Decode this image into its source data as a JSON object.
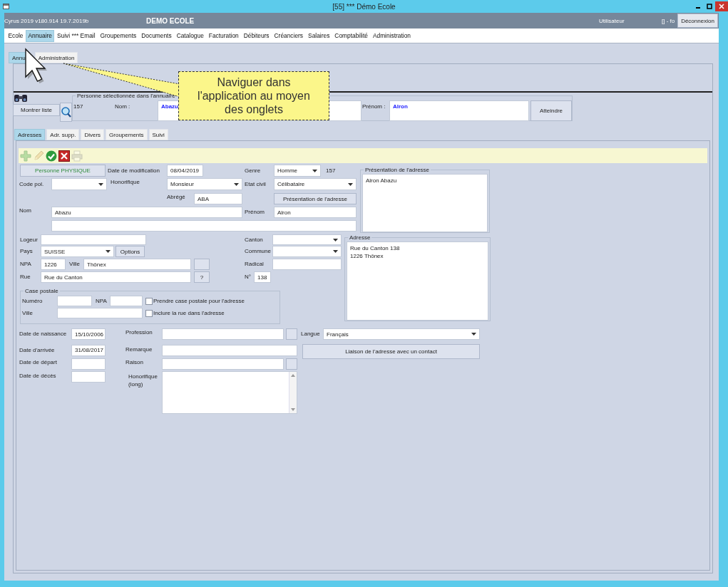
{
  "window": {
    "title": "[55] *** Démo Ecole"
  },
  "header": {
    "version": "Cyrus 2019 v180.914 19.7.2019b",
    "school": "DEMO ECOLE",
    "user_label": "Utilisateur",
    "user_value": "[] - fo",
    "logout_button": "Déconnexion"
  },
  "menu": [
    {
      "label": "Ecole",
      "selected": false
    },
    {
      "label": "Annuaire",
      "selected": true
    },
    {
      "label": "Suivi *** Email",
      "selected": false
    },
    {
      "label": "Groupements",
      "selected": false
    },
    {
      "label": "Documents",
      "selected": false
    },
    {
      "label": "Catalogue",
      "selected": false
    },
    {
      "label": "Facturation",
      "selected": false
    },
    {
      "label": "Débiteurs",
      "selected": false
    },
    {
      "label": "Créanciers",
      "selected": false
    },
    {
      "label": "Salaires",
      "selected": false
    },
    {
      "label": "Comptabilité",
      "selected": false
    },
    {
      "label": "Administration",
      "selected": false
    }
  ],
  "subtabs": [
    {
      "label": "Annu",
      "selected": true
    },
    {
      "label": "Administration",
      "selected": false
    }
  ],
  "person_selector": {
    "legend": "Personne sélectionnée dans l'annuaire",
    "id": "157",
    "nom_label": "Nom :",
    "nom": "Abazu",
    "prenom_label": "Prénom :",
    "prenom": "Alron",
    "show_list_button": "Montrer liste",
    "go_button": "Atteindre"
  },
  "detail_tabs": [
    {
      "label": "Adresses",
      "selected": true
    },
    {
      "label": "Adr. supp.",
      "selected": false
    },
    {
      "label": "Divers",
      "selected": false
    },
    {
      "label": "Groupements",
      "selected": false
    },
    {
      "label": "Suivi",
      "selected": false
    }
  ],
  "toolbar": [
    {
      "kind": "add",
      "disabled": true
    },
    {
      "kind": "edit",
      "disabled": true
    },
    {
      "kind": "confirm",
      "disabled": false
    },
    {
      "kind": "cancel",
      "disabled": false
    },
    {
      "kind": "print",
      "disabled": true
    }
  ],
  "address_form": {
    "person_type_button": "Personne PHYSIQUE",
    "modification_date": {
      "label": "Date de modification",
      "value": "08/04/2019"
    },
    "gender": {
      "label": "Genre",
      "value": "Homme"
    },
    "person_number": "157",
    "political_code": {
      "label": "Code pol."
    },
    "honorific": {
      "label": "Honorifique",
      "value": "Monsieur"
    },
    "civil_status": {
      "label": "Etat civil",
      "value": "Célibataire"
    },
    "abbreviation": {
      "label": "Abrégé",
      "value": "ABA"
    },
    "presentation_button": "Présentation de l'adresse",
    "last_name": {
      "label": "Nom",
      "value": "Abazu"
    },
    "first_name": {
      "label": "Prénom",
      "value": "Alron"
    },
    "presentation_box": {
      "legend": "Présentation de l'adresse",
      "text": "Alron Abazu"
    },
    "lodger": {
      "label": "Logeur"
    },
    "country": {
      "label": "Pays",
      "value": "SUISSE"
    },
    "options_button": "Options",
    "postcode": {
      "label": "NPA",
      "value": "1226"
    },
    "city": {
      "label": "Ville",
      "value": "Thônex"
    },
    "street": {
      "label": "Rue",
      "value": "Rue du Canton"
    },
    "street_help_button": "?",
    "canton": {
      "label": "Canton"
    },
    "commune": {
      "label": "Commune"
    },
    "radical": {
      "label": "Radical"
    },
    "house_number": {
      "label": "N°",
      "value": "138"
    },
    "po_box": {
      "legend": "Case postale",
      "number_label": "Numéro",
      "postcode_label": "NPA",
      "city_label": "Ville",
      "options": [
        {
          "label": "Prendre case postale pour l'adresse",
          "checked": false
        },
        {
          "label": "Inclure la rue dans l'adresse",
          "checked": false
        }
      ]
    },
    "address_box": {
      "legend": "Adresse",
      "lines": [
        "Rue du Canton 138",
        "1226 Thônex"
      ]
    },
    "birth_date": {
      "label": "Date de naissance",
      "value": "15/10/2006"
    },
    "arrival_date": {
      "label": "Date d'arrivée",
      "value": "31/08/2017"
    },
    "departure_date": {
      "label": "Date de départ"
    },
    "death_date": {
      "label": "Date de décès"
    },
    "profession": {
      "label": "Profession"
    },
    "remark": {
      "label": "Remarque"
    },
    "reason": {
      "label": "Raison"
    },
    "long_honorific": {
      "label": "Honorifique (long)"
    },
    "language": {
      "label": "Langue",
      "value": "Français"
    },
    "contact_link_button": "Liaison de l'adresse avec un contact"
  },
  "callout": {
    "text": "Naviguer dans l'application au moyen des onglets"
  }
}
